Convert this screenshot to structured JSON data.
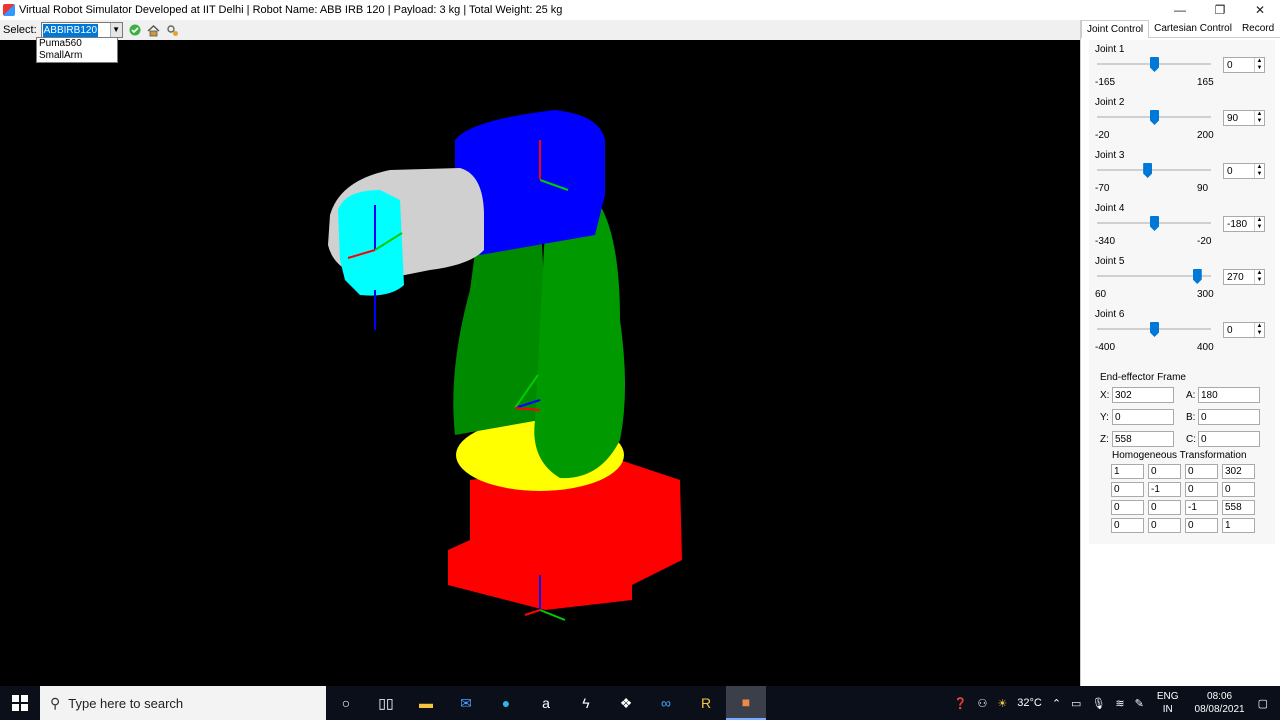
{
  "window": {
    "title": "Virtual Robot Simulator Developed at IIT Delhi | Robot Name: ABB IRB 120 | Payload: 3 kg | Total Weight: 25 kg",
    "minimize": "—",
    "maximize": "❐",
    "close": "✕"
  },
  "toolbar": {
    "select_label": "Select:",
    "selected_robot": "ABBIRB120",
    "dropdown_options": [
      "Puma560",
      "SmallArm"
    ],
    "icons": [
      "check-icon",
      "home-icon",
      "settings-icon"
    ]
  },
  "panel": {
    "tabs": [
      "Joint Control",
      "Cartesian Control",
      "Record"
    ],
    "active_tab": "Joint Control",
    "joints": [
      {
        "name": "Joint 1",
        "min": "-165",
        "max": "165",
        "value": "0",
        "level": 0.5
      },
      {
        "name": "Joint 2",
        "min": "-20",
        "max": "200",
        "value": "90",
        "level": 0.5
      },
      {
        "name": "Joint 3",
        "min": "-70",
        "max": "90",
        "value": "0",
        "level": 0.44
      },
      {
        "name": "Joint 4",
        "min": "-340",
        "max": "-20",
        "value": "-180",
        "level": 0.5
      },
      {
        "name": "Joint 5",
        "min": "60",
        "max": "300",
        "value": "270",
        "level": 0.875
      },
      {
        "name": "Joint 6",
        "min": "-400",
        "max": "400",
        "value": "0",
        "level": 0.5
      }
    ],
    "end_effector": {
      "title": "End-effector Frame",
      "x_label": "X:",
      "x": "302",
      "y_label": "Y:",
      "y": "0",
      "z_label": "Z:",
      "z": "558",
      "a_label": "A:",
      "a": "180",
      "b_label": "B:",
      "b": "0",
      "c_label": "C:",
      "c": "0",
      "ht_title": "Homogeneous Transformation",
      "matrix": [
        [
          "1",
          "0",
          "0",
          "302"
        ],
        [
          "0",
          "-1",
          "0",
          "0"
        ],
        [
          "0",
          "0",
          "-1",
          "558"
        ],
        [
          "0",
          "0",
          "0",
          "1"
        ]
      ]
    }
  },
  "taskbar": {
    "search_placeholder": "Type here to search",
    "temperature": "32°C",
    "lang": "ENG",
    "region": "IN",
    "time": "08:06",
    "date": "08/08/2021"
  },
  "colors": {
    "base": "#ff0000",
    "shoulder": "#ffff00",
    "arm": "#008000",
    "elbow": "#0000ff",
    "wrist": "#c8c8c8",
    "tool": "#00ffff",
    "accent": "#0078d7"
  }
}
